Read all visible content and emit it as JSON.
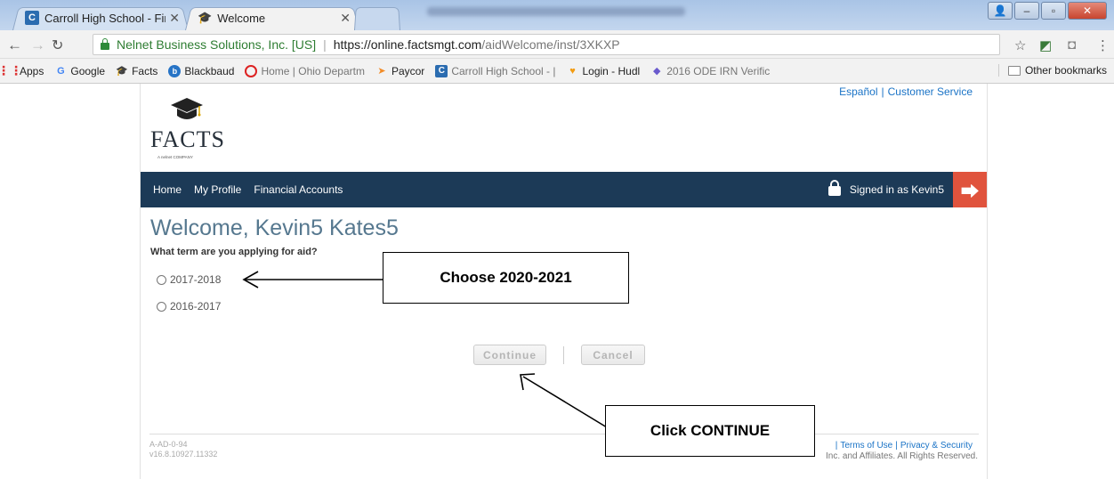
{
  "browser": {
    "tabs": [
      {
        "label": "Carroll High School - Fin",
        "active": false
      },
      {
        "label": "Welcome",
        "active": true
      }
    ],
    "window_buttons": [
      "minimize",
      "maximize",
      "close"
    ],
    "omnibox": {
      "org": "Nelnet Business Solutions, Inc. [US]",
      "url_host": "https://online.factsmgt.com",
      "url_path": "/aidWelcome/inst/3XKXP"
    },
    "bookmarks": [
      {
        "label": "Apps",
        "icon": "apps-grid-icon"
      },
      {
        "label": "Google",
        "icon": "google-icon"
      },
      {
        "label": "Facts",
        "icon": "graduation-cap-icon"
      },
      {
        "label": "Blackbaud",
        "icon": "blackbaud-icon"
      },
      {
        "label": "Home | Ohio Departm",
        "icon": "ohio-icon"
      },
      {
        "label": "Paycor",
        "icon": "paycor-icon"
      },
      {
        "label": "Carroll High School - |",
        "icon": "carroll-icon"
      },
      {
        "label": "Login - Hudl",
        "icon": "hudl-icon"
      },
      {
        "label": "2016 ODE IRN Verific",
        "icon": "ode-icon"
      }
    ],
    "other_bookmarks": "Other bookmarks"
  },
  "header": {
    "util_links": [
      "Español",
      "Customer Service"
    ],
    "logo_text": "FACTS",
    "logo_sub": "A nelnet COMPANY"
  },
  "nav": {
    "items": [
      "Home",
      "My Profile",
      "Financial Accounts"
    ],
    "signed_in": "Signed in as Kevin5"
  },
  "main": {
    "welcome": "Welcome, Kevin5 Kates5",
    "question": "What term are you applying for aid?",
    "options": [
      "2017-2018",
      "2016-2017"
    ],
    "continue_label": "Continue",
    "cancel_label": "Cancel"
  },
  "footer": {
    "code": "A-AD-0-94",
    "version": "v16.8.10927.11332",
    "links": [
      "Terms of Use",
      "Privacy & Security"
    ],
    "copyright": "Inc. and Affiliates. All Rights Reserved."
  },
  "annotations": {
    "callout1": "Choose 2020-2021",
    "callout2": "Click CONTINUE"
  },
  "colors": {
    "navbar": "#1c3a57",
    "logout": "#e0533d",
    "welcome": "#56788f",
    "link": "#1a73c6"
  }
}
